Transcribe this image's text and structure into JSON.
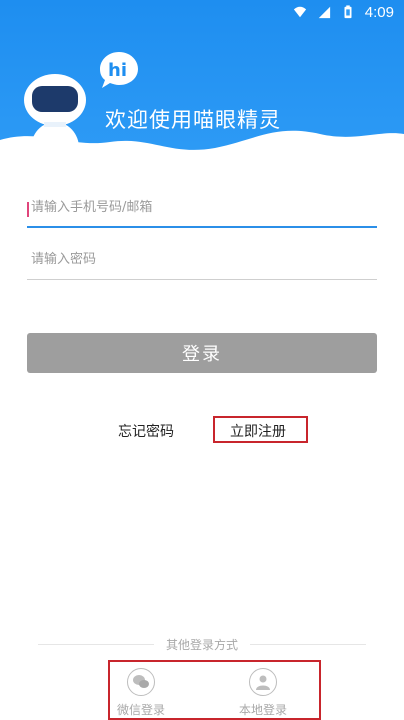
{
  "status_bar": {
    "time": "4:09",
    "icons": [
      "wifi-icon",
      "signal-icon",
      "battery-icon"
    ]
  },
  "header": {
    "logo_text": "hi",
    "welcome": "欢迎使用喵眼精灵"
  },
  "form": {
    "account_placeholder": "请输入手机号码/邮箱",
    "account_value": "",
    "password_placeholder": "请输入密码",
    "password_value": ""
  },
  "login_button": "登录",
  "links": {
    "forgot": "忘记密码",
    "register": "立即注册"
  },
  "other_login": {
    "title": "其他登录方式",
    "options": [
      {
        "label": "微信登录",
        "icon": "wechat-icon"
      },
      {
        "label": "本地登录",
        "icon": "user-icon"
      }
    ]
  },
  "colors": {
    "header_blue": "#2196f3",
    "focus_underline": "#2b8fe8",
    "button_disabled": "#9e9e9e",
    "highlight_red": "#c8252c"
  }
}
